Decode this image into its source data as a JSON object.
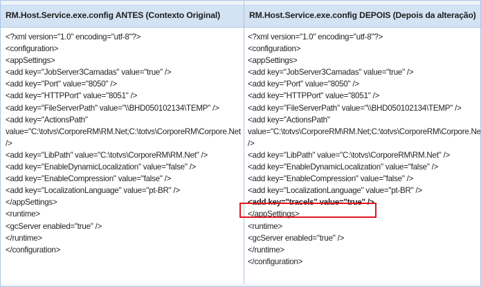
{
  "left": {
    "header": "RM.Host.Service.exe.config ANTES (Contexto Original)",
    "lines": [
      "<?xml version=\"1.0\" encoding=\"utf-8\"?>",
      "<configuration>",
      "<appSettings>",
      "<add key=\"JobServer3Camadas\" value=\"true\" />",
      "<add key=\"Port\" value=\"8050\" />",
      "<add key=\"HTTPPort\" value=\"8051\" />",
      "<add key=\"FileServerPath\" value=\"\\\\BHD050102134\\TEMP\" />",
      "<add key=\"ActionsPath\"",
      "value=\"C:\\totvs\\CorporeRM\\RM.Net;C:\\totvs\\CorporeRM\\Corpore.Net\\Bin\"",
      "/>",
      "<add key=\"LibPath\" value=\"C:\\totvs\\CorporeRM\\RM.Net\" />",
      "<add key=\"EnableDynamicLocalization\" value=\"false\" />",
      "<add key=\"EnableCompression\" value=\"false\" />",
      "<add key=\"LocalizationLanguage\" value=\"pt-BR\" />",
      "</appSettings>",
      "<runtime>",
      "<gcServer enabled=\"true\" />",
      "</runtime>",
      "</configuration>"
    ]
  },
  "right": {
    "header": "RM.Host.Service.exe.config DEPOIS (Depois da alteração)",
    "lines": [
      "<?xml version=\"1.0\" encoding=\"utf-8\"?>",
      "<configuration>",
      "<appSettings>",
      "<add key=\"JobServer3Camadas\" value=\"true\" />",
      "<add key=\"Port\" value=\"8050\" />",
      "<add key=\"HTTPPort\" value=\"8051\" />",
      "<add key=\"FileServerPath\" value=\"\\\\BHD050102134\\TEMP\" />",
      "<add key=\"ActionsPath\"",
      "value=\"C:\\totvs\\CorporeRM\\RM.Net;C:\\totvs\\CorporeRM\\Corpore.Net\\Bin",
      "/>",
      "<add key=\"LibPath\" value=\"C:\\totvs\\CorporeRM\\RM.Net\" />",
      "<add key=\"EnableDynamicLocalization\" value=\"false\" />",
      "<add key=\"EnableCompression\" value=\"false\" />",
      "<add key=\"LocalizationLanguage\" value=\"pt-BR\" />",
      "<add key=\"tracels\" value=\"true\" />",
      "</appSettings>",
      "<runtime>",
      "<gcServer enabled=\"true\" />",
      "</runtime>",
      "</configuration>"
    ],
    "highlighted_line_index": 14
  },
  "colors": {
    "header_background": "#d4e3f3",
    "border": "#a9c6e6",
    "highlight_border": "#e0141c"
  }
}
